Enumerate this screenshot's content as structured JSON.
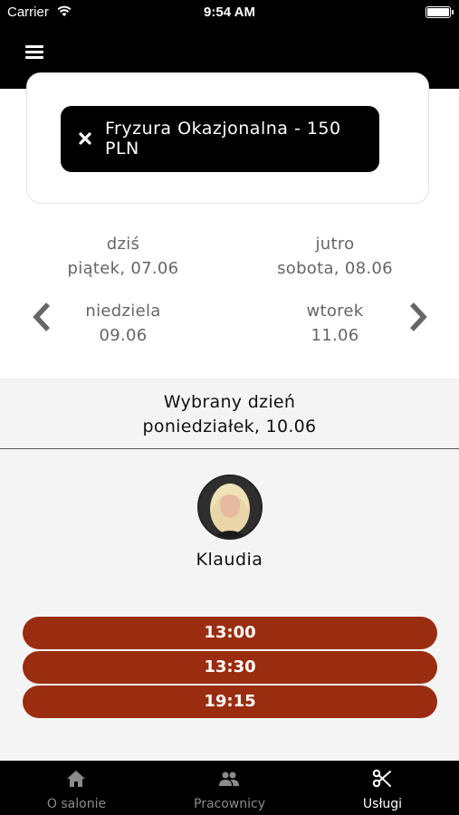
{
  "status_bar": {
    "carrier": "Carrier",
    "time": "9:54 AM"
  },
  "service": {
    "label": "Fryzura Okazjonalna - 150 PLN"
  },
  "days": [
    {
      "name": "dziś",
      "date": "piątek, 07.06"
    },
    {
      "name": "jutro",
      "date": "sobota, 08.06"
    },
    {
      "name": "niedziela",
      "date": "09.06"
    },
    {
      "name": "wtorek",
      "date": "11.06"
    }
  ],
  "selected_day": {
    "heading": "Wybrany dzień",
    "value": "poniedziałek, 10.06"
  },
  "staff": {
    "name": "Klaudia"
  },
  "time_slots": [
    "13:00",
    "13:30",
    "19:15"
  ],
  "tabs": [
    {
      "label": "O salonie",
      "icon": "home-icon",
      "active": false
    },
    {
      "label": "Pracownicy",
      "icon": "people-icon",
      "active": false
    },
    {
      "label": "Usługi",
      "icon": "scissors-icon",
      "active": true
    }
  ],
  "colors": {
    "slot": "#9a2d10",
    "header": "#000000",
    "inactive_tab": "#8b8b8b"
  }
}
